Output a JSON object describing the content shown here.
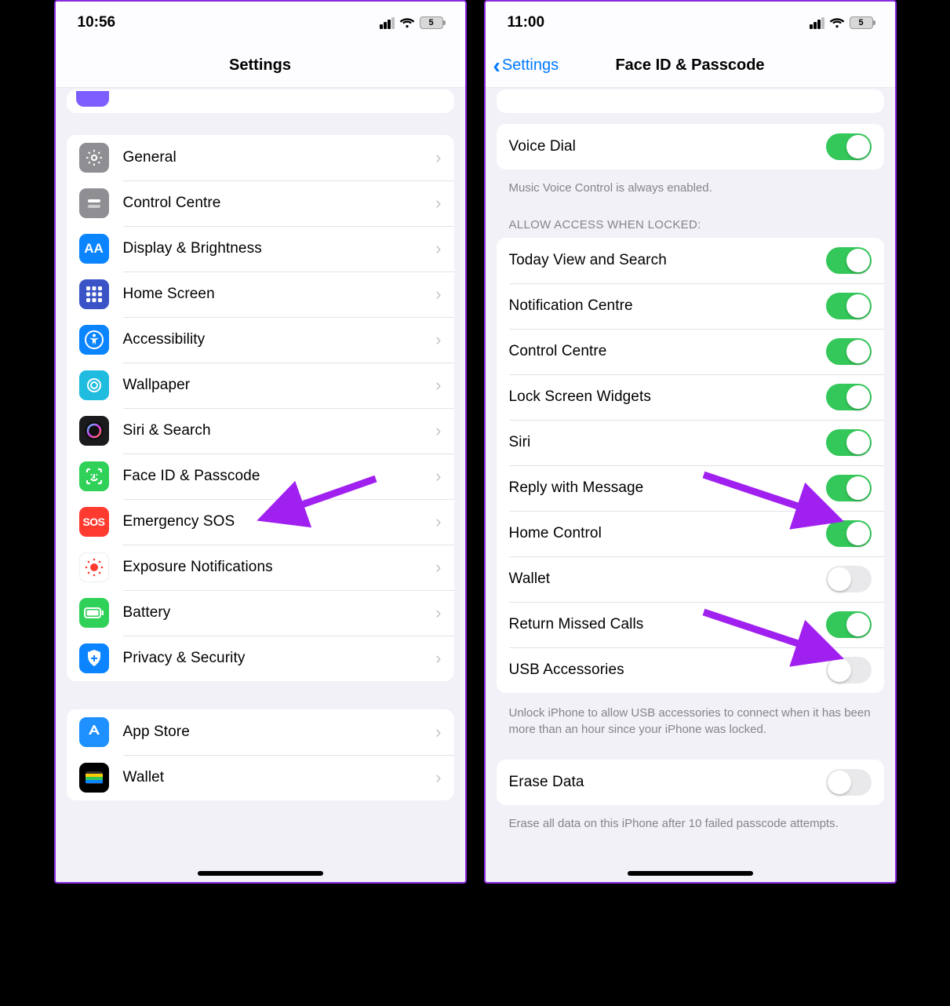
{
  "left": {
    "time": "10:56",
    "battery": "5",
    "title": "Settings",
    "rows": [
      {
        "id": "general",
        "label": "General"
      },
      {
        "id": "control-centre",
        "label": "Control Centre"
      },
      {
        "id": "display",
        "label": "Display & Brightness"
      },
      {
        "id": "home-screen",
        "label": "Home Screen"
      },
      {
        "id": "accessibility",
        "label": "Accessibility"
      },
      {
        "id": "wallpaper",
        "label": "Wallpaper"
      },
      {
        "id": "siri",
        "label": "Siri & Search"
      },
      {
        "id": "faceid",
        "label": "Face ID & Passcode"
      },
      {
        "id": "sos",
        "label": "Emergency SOS"
      },
      {
        "id": "exposure",
        "label": "Exposure Notifications"
      },
      {
        "id": "battery",
        "label": "Battery"
      },
      {
        "id": "privacy",
        "label": "Privacy & Security"
      }
    ],
    "rows2": [
      {
        "id": "appstore",
        "label": "App Store"
      },
      {
        "id": "wallet",
        "label": "Wallet"
      }
    ]
  },
  "right": {
    "time": "11:00",
    "battery": "5",
    "back": "Settings",
    "title": "Face ID & Passcode",
    "voice_dial": {
      "label": "Voice Dial",
      "on": true
    },
    "voice_caption": "Music Voice Control is always enabled.",
    "section_header": "ALLOW ACCESS WHEN LOCKED:",
    "locked_rows": [
      {
        "id": "today",
        "label": "Today View and Search",
        "on": true
      },
      {
        "id": "notif",
        "label": "Notification Centre",
        "on": true
      },
      {
        "id": "cc",
        "label": "Control Centre",
        "on": true
      },
      {
        "id": "lsw",
        "label": "Lock Screen Widgets",
        "on": true
      },
      {
        "id": "siri",
        "label": "Siri",
        "on": true
      },
      {
        "id": "reply",
        "label": "Reply with Message",
        "on": true
      },
      {
        "id": "homec",
        "label": "Home Control",
        "on": true
      },
      {
        "id": "wallet",
        "label": "Wallet",
        "on": false
      },
      {
        "id": "missed",
        "label": "Return Missed Calls",
        "on": true
      },
      {
        "id": "usb",
        "label": "USB Accessories",
        "on": false
      }
    ],
    "usb_caption": "Unlock iPhone to allow USB accessories to connect when it has been more than an hour since your iPhone was locked.",
    "erase": {
      "label": "Erase Data",
      "on": false
    },
    "erase_caption": "Erase all data on this iPhone after 10 failed passcode attempts."
  }
}
